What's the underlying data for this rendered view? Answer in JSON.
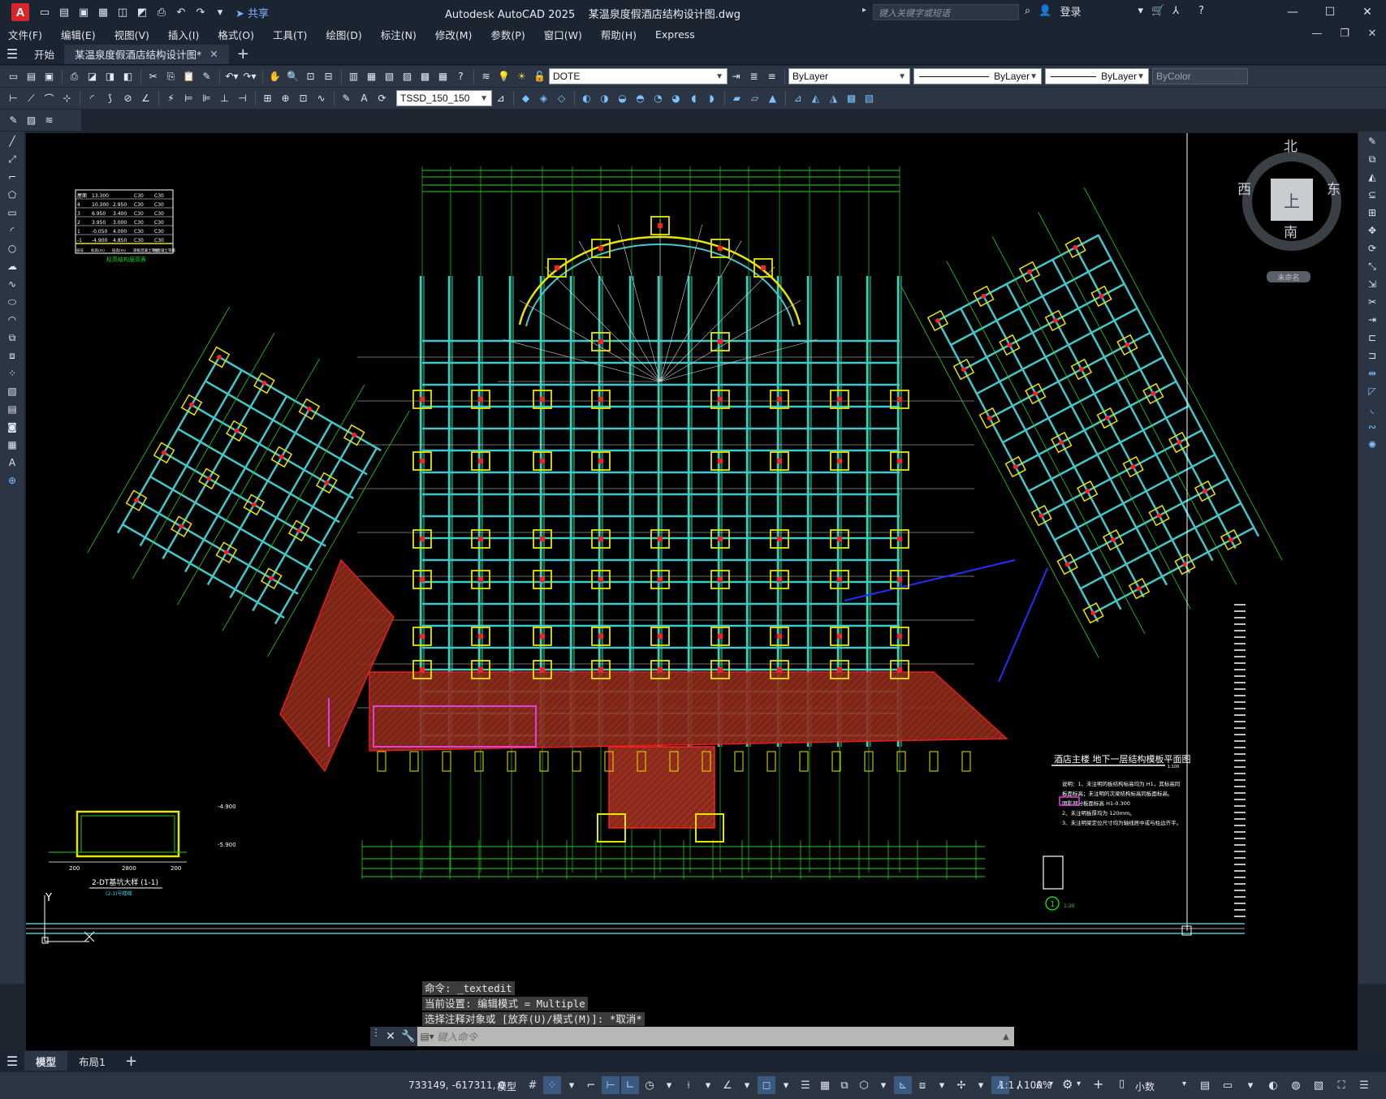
{
  "app": {
    "title": "Autodesk AutoCAD 2025    某温泉度假酒店结构设计图.dwg",
    "logo": "A",
    "share_label": "共享",
    "search_placeholder": "键入关键字或短语",
    "login_label": "登录"
  },
  "menu": [
    "文件(F)",
    "编辑(E)",
    "视图(V)",
    "插入(I)",
    "格式(O)",
    "工具(T)",
    "绘图(D)",
    "标注(N)",
    "修改(M)",
    "参数(P)",
    "窗口(W)",
    "帮助(H)",
    "Express"
  ],
  "doc_tabs": [
    {
      "label": "开始"
    },
    {
      "label": "某温泉度假酒店结构设计图*"
    }
  ],
  "toolbar": {
    "layer_name": "DOTE",
    "color": "ByLayer",
    "linetype": "ByLayer",
    "lineweight": "ByLayer",
    "plotstyle": "ByColor",
    "dimstyle": "TSSD_150_150"
  },
  "viewcube": {
    "north": "北",
    "south": "南",
    "east": "东",
    "west": "西",
    "face": "上",
    "wcs": "未命名"
  },
  "drawing": {
    "plan_title": "酒店主楼 地下一层结构模板平面图",
    "plan_scale": "1:100",
    "table_title": "标高结构层高表",
    "table_header": [
      "层号",
      "标高(m)",
      "层高(m)",
      "梁板混凝土等级",
      "柱混凝土等级"
    ],
    "table_rows": [
      [
        "屋面",
        "13.300",
        "",
        "C30",
        "C30"
      ],
      [
        "4",
        "10.300",
        "2.950",
        "C30",
        "C30"
      ],
      [
        "3",
        "6.950",
        "3.400",
        "C30",
        "C30"
      ],
      [
        "2",
        "3.950",
        "3.000",
        "C30",
        "C30"
      ],
      [
        "1",
        "-0.050",
        "4.000",
        "C30",
        "C30"
      ],
      [
        "-1",
        "-4.900",
        "4.850",
        "C30",
        "C30"
      ]
    ],
    "section_title": "2-DT基坑大样 (1-1)",
    "section_note": "(2-1)号楼梯",
    "section_dims": [
      "200",
      "2800",
      "200"
    ],
    "section_levels": [
      "-4.900",
      "-5.900"
    ],
    "notes": [
      "说明：1、未注明的板结构标高均为 H1，其标高同",
      "板面标高；未注明的次梁结构标高同板面标高。",
      "阴影部分板面标高 H1-0.300",
      "2、未注明板厚均为 120mm。",
      "3、未注明梁定位尺寸均为轴线居中或与柱边齐平。"
    ],
    "detail_label": "1",
    "detail_scale": "1:20",
    "ucs_y": "Y"
  },
  "command_history": [
    "命令: _textedit",
    "当前设置: 编辑模式 = Multiple",
    "选择注释对象或 [放弃(U)/模式(M)]: *取消*"
  ],
  "command_placeholder": "键入命令",
  "layout_tabs": [
    "模型",
    "布局1"
  ],
  "status": {
    "coords": "733149, -617311, 0",
    "space": "模型",
    "scale": "1:1 / 100%",
    "units": "小数"
  },
  "colors": {
    "canvas": "#000000",
    "grid_beam": "#42c8c8",
    "dim": "#1ed21e",
    "column": "#e6e600",
    "hatch": "#8a2a1a",
    "red": "#ff2020",
    "magenta": "#e040e0",
    "blue": "#2030ff",
    "ui_bg": "#1b2431",
    "toolbar_bg": "#2b3544"
  }
}
